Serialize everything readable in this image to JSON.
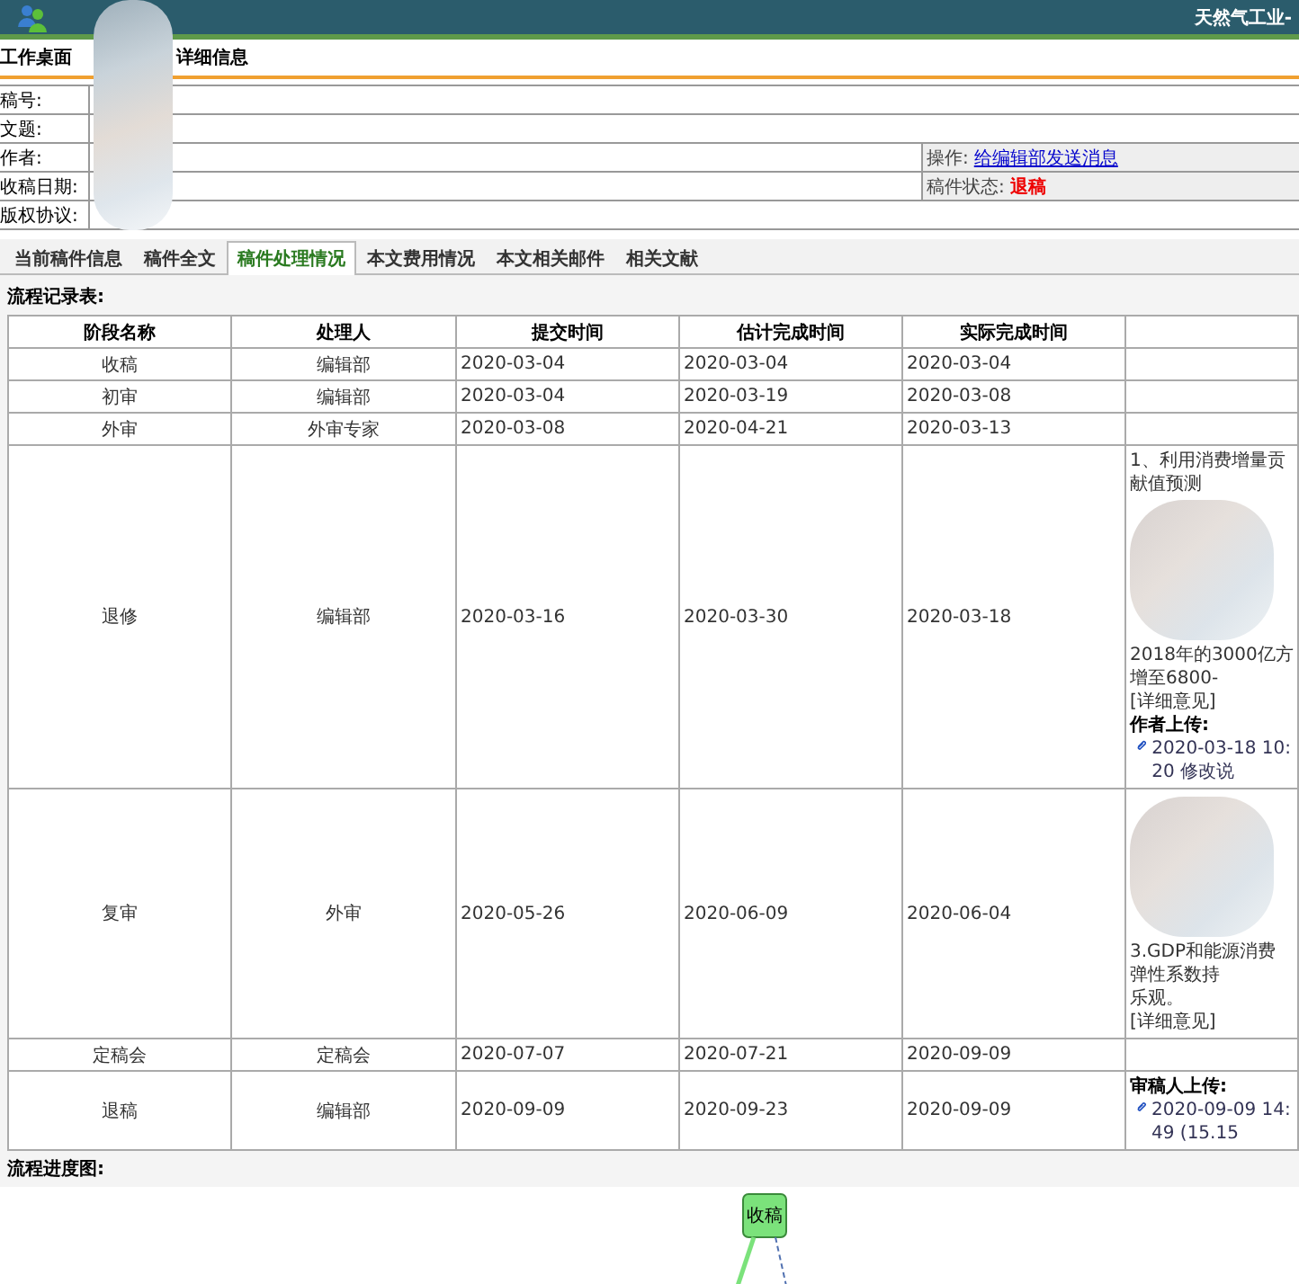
{
  "header": {
    "title": "天然气工业-"
  },
  "breadcrumb": [
    "工作桌面",
    "详细信息"
  ],
  "info": {
    "rows": [
      {
        "label": "稿号:"
      },
      {
        "label": "文题:"
      },
      {
        "label": "作者:",
        "side_label": "操作:",
        "side_link": "给编辑部发送消息"
      },
      {
        "label": "收稿日期:",
        "side_label": "稿件状态:",
        "side_status": "退稿"
      },
      {
        "label": "版权协议:"
      }
    ]
  },
  "tabs": [
    {
      "label": "当前稿件信息",
      "selected": false
    },
    {
      "label": "稿件全文",
      "selected": false
    },
    {
      "label": "稿件处理情况",
      "selected": true
    },
    {
      "label": "本文费用情况",
      "selected": false
    },
    {
      "label": "本文相关邮件",
      "selected": false
    },
    {
      "label": "相关文献",
      "selected": false
    }
  ],
  "process_table": {
    "title": "流程记录表:",
    "columns": [
      "阶段名称",
      "处理人",
      "提交时间",
      "估计完成时间",
      "实际完成时间"
    ],
    "rows": [
      {
        "stage": "收稿",
        "handler": "编辑部",
        "submitted": "2020-03-04",
        "estimated": "2020-03-04",
        "actual": "2020-03-04"
      },
      {
        "stage": "初审",
        "handler": "编辑部",
        "submitted": "2020-03-04",
        "estimated": "2020-03-19",
        "actual": "2020-03-08"
      },
      {
        "stage": "外审",
        "handler": "外审专家",
        "submitted": "2020-03-08",
        "estimated": "2020-04-21",
        "actual": "2020-03-13"
      },
      {
        "stage": "退修",
        "handler": "编辑部",
        "submitted": "2020-03-16",
        "estimated": "2020-03-30",
        "actual": "2020-03-18",
        "comment": {
          "lines_before": [
            "1、利用消费增量贡献值预测"
          ],
          "redacted": true,
          "lines_after": [
            "2018年的3000亿方增至6800-"
          ],
          "link": "[详细意见]",
          "upload_label": "作者上传:",
          "file": "2020-03-18 10:20 修改说"
        }
      },
      {
        "stage": "复审",
        "handler": "外审",
        "submitted": "2020-05-26",
        "estimated": "2020-06-09",
        "actual": "2020-06-04",
        "comment": {
          "redacted": true,
          "lines_after": [
            "3.GDP和能源消费弹性系数持",
            "乐观。"
          ],
          "link": "[详细意见]"
        }
      },
      {
        "stage": "定稿会",
        "handler": "定稿会",
        "submitted": "2020-07-07",
        "estimated": "2020-07-21",
        "actual": "2020-09-09"
      },
      {
        "stage": "退稿",
        "handler": "编辑部",
        "submitted": "2020-09-09",
        "estimated": "2020-09-23",
        "actual": "2020-09-09",
        "comment": {
          "upload_label": "审稿人上传:",
          "file": "2020-09-09 14:49 (15.15"
        }
      }
    ]
  },
  "flow_chart": {
    "title": "流程进度图:",
    "nodes": [
      {
        "label": "收稿"
      }
    ]
  }
}
